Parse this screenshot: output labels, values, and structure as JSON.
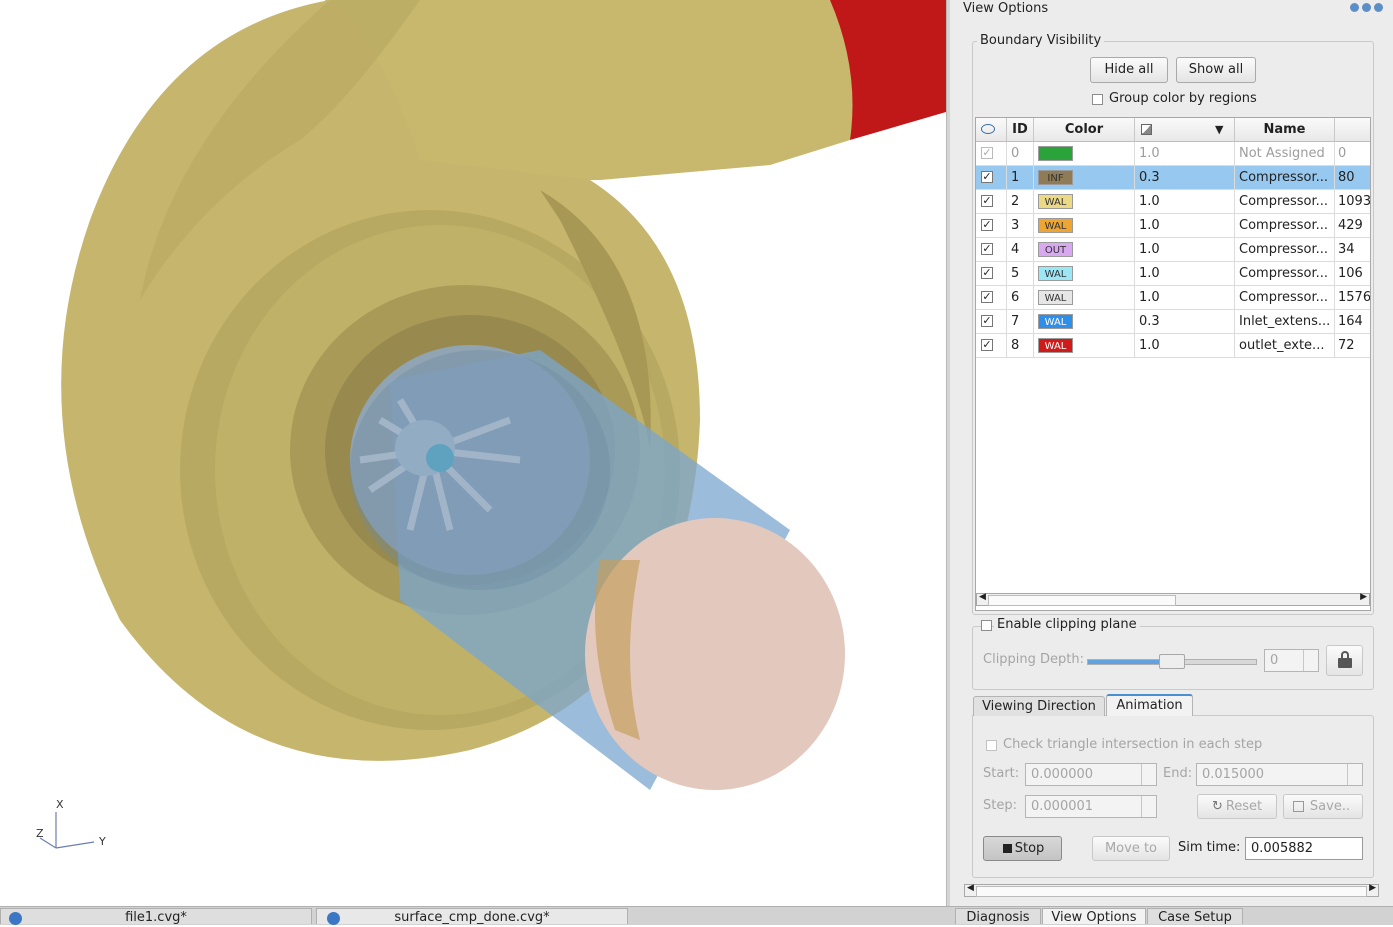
{
  "viewport": {
    "axes": {
      "x_label": "X",
      "y_label": "Y",
      "z_label": "Z"
    }
  },
  "panel": {
    "title": "View Options",
    "boundary_group_title": "Boundary Visibility",
    "hide_all_label": "Hide all",
    "show_all_label": "Show all",
    "group_color_label": "Group color by regions",
    "table": {
      "headers": {
        "id": "ID",
        "color": "Color",
        "name": "Name"
      },
      "rows": [
        {
          "visible": true,
          "disabled": true,
          "id": "0",
          "color": "#2aa43a",
          "tag": "",
          "opacity": "1.0",
          "name": "Not Assigned",
          "count": "0"
        },
        {
          "visible": true,
          "selected": true,
          "id": "1",
          "color": "#8f7b55",
          "tag": "INF",
          "opacity": "0.3",
          "name": "Compressor...",
          "count": "80"
        },
        {
          "visible": true,
          "id": "2",
          "color": "#ecd985",
          "tag": "WAL",
          "opacity": "1.0",
          "name": "Compressor...",
          "count": "1093"
        },
        {
          "visible": true,
          "id": "3",
          "color": "#eea531",
          "tag": "WAL",
          "opacity": "1.0",
          "name": "Compressor...",
          "count": "429"
        },
        {
          "visible": true,
          "id": "4",
          "color": "#d8a8f0",
          "tag": "OUT",
          "opacity": "1.0",
          "name": "Compressor...",
          "count": "34"
        },
        {
          "visible": true,
          "id": "5",
          "color": "#9be7f5",
          "tag": "WAL",
          "opacity": "1.0",
          "name": "Compressor...",
          "count": "106"
        },
        {
          "visible": true,
          "id": "6",
          "color": "#e6e6e6",
          "tag": "WAL",
          "opacity": "1.0",
          "name": "Compressor...",
          "count": "1576"
        },
        {
          "visible": true,
          "id": "7",
          "color": "#2f8fe8",
          "tag": "WAL",
          "opacity": "0.3",
          "name": "Inlet_extens...",
          "count": "164"
        },
        {
          "visible": true,
          "id": "8",
          "color": "#d01b1b",
          "tag": "WAL",
          "opacity": "1.0",
          "name": "outlet_exte...",
          "count": "72"
        }
      ]
    },
    "clipping": {
      "enable_label": "Enable clipping plane",
      "depth_label": "Clipping Depth:",
      "depth_value": "0",
      "slider_level": 0.5
    },
    "tabs": {
      "viewing_direction": "Viewing Direction",
      "animation": "Animation"
    },
    "animation": {
      "check_label": "Check triangle intersection in each step",
      "start_label": "Start:",
      "start_value": "0.000000",
      "end_label": "End:",
      "end_value": "0.015000",
      "step_label": "Step:",
      "step_value": "0.000001",
      "reset_label": "Reset",
      "save_label": "Save..",
      "stop_label": "Stop",
      "move_to_label": "Move to",
      "sim_time_label": "Sim time:",
      "sim_time_value": "0.005882"
    }
  },
  "bottom_tabs": {
    "file1": "file1.cvg*",
    "file2": "surface_cmp_done.cvg*",
    "diagnosis": "Diagnosis",
    "view_options": "View Options",
    "case_setup": "Case Setup"
  }
}
